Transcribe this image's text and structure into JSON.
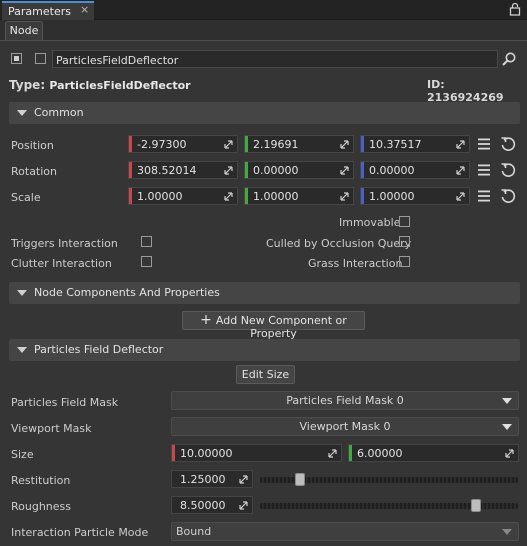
{
  "window": {
    "tab_title": "Parameters",
    "tab_close": "×"
  },
  "subtabs": {
    "node": "Node"
  },
  "node": {
    "name": "ParticlesFieldDeflector",
    "type_label": "Type:",
    "type_value": "ParticlesFieldDeflector",
    "id_label": "ID:",
    "id_value": "2136924269"
  },
  "common": {
    "title": "Common",
    "position": {
      "label": "Position",
      "x": "-2.97300",
      "y": "2.19691",
      "z": "10.37517"
    },
    "rotation": {
      "label": "Rotation",
      "x": "308.52014",
      "y": "0.00000",
      "z": "0.00000"
    },
    "scale": {
      "label": "Scale",
      "x": "1.00000",
      "y": "1.00000",
      "z": "1.00000"
    },
    "immovable": "Immovable",
    "triggers_interaction": "Triggers Interaction",
    "culled_by_occlusion": "Culled by Occlusion Query",
    "clutter_interaction": "Clutter Interaction",
    "grass_interaction": "Grass Interaction"
  },
  "components": {
    "title": "Node Components And Properties",
    "add_button": "Add New Component or Property"
  },
  "deflector": {
    "title": "Particles Field Deflector",
    "edit_size": "Edit Size",
    "mask_label": "Particles Field Mask",
    "mask_value": "Particles Field Mask 0",
    "viewport_label": "Viewport Mask",
    "viewport_value": "Viewport Mask 0",
    "size_label": "Size",
    "size_x": "10.00000",
    "size_y": "6.00000",
    "restitution_label": "Restitution",
    "restitution_value": "1.25000",
    "restitution_level": 0.14,
    "roughness_label": "Roughness",
    "roughness_value": "8.50000",
    "roughness_level": 0.85,
    "interaction_mode_label": "Interaction Particle Mode",
    "interaction_mode_value": "Bound"
  },
  "colors": {
    "x_axis": "#c8474d",
    "y_axis": "#44a843",
    "z_axis": "#4a5fc8",
    "accent": "#4a8fd6"
  }
}
